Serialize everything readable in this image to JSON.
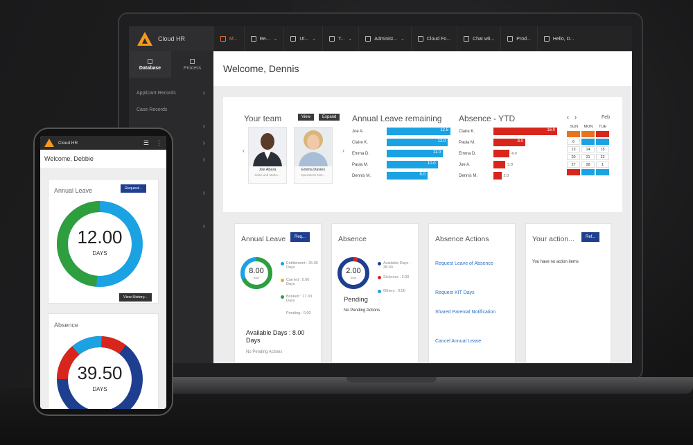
{
  "app": {
    "name": "Cloud HR"
  },
  "nav": [
    {
      "label": "M...",
      "icon": "arrows-icon",
      "active": true,
      "dropdown": false
    },
    {
      "label": "Re...",
      "icon": "report-icon",
      "active": false,
      "dropdown": true
    },
    {
      "label": "Ut...",
      "icon": "grid-icon",
      "active": false,
      "dropdown": true
    },
    {
      "label": "T...",
      "icon": "tools-icon",
      "active": false,
      "dropdown": true
    },
    {
      "label": "Administ...",
      "icon": "admin-icon",
      "active": false,
      "dropdown": true
    },
    {
      "label": "Cloud Fo...",
      "icon": "folder-icon",
      "active": false,
      "dropdown": false
    },
    {
      "label": "Chat wit...",
      "icon": "chat-icon",
      "active": false,
      "dropdown": false
    },
    {
      "label": "Prod...",
      "icon": "product-icon",
      "active": false,
      "dropdown": false
    },
    {
      "label": "Hello, D...",
      "icon": "user-icon",
      "active": false,
      "dropdown": false
    }
  ],
  "sidebar": {
    "tabs": [
      {
        "label": "Database",
        "active": true
      },
      {
        "label": "Process",
        "active": false
      }
    ],
    "items": [
      {
        "label": "Applicant Records",
        "has_arrow": true
      },
      {
        "label": "Case Records",
        "has_arrow": false
      },
      {
        "label": "",
        "has_arrow": true
      },
      {
        "label": "",
        "has_arrow": true
      },
      {
        "label": "",
        "has_arrow": true
      },
      {
        "label": "",
        "has_arrow": false
      },
      {
        "label": "",
        "has_arrow": true
      },
      {
        "label": "",
        "has_arrow": false
      },
      {
        "label": "",
        "has_arrow": true
      }
    ]
  },
  "main": {
    "welcome": "Welcome, Dennis"
  },
  "team": {
    "title": "Your team",
    "view_label": "View",
    "expand_label": "Expand",
    "people": [
      {
        "name": "Joe Abara",
        "role": "Sales and Marke..."
      },
      {
        "name": "Emma Davies",
        "role": "Operations Dire..."
      }
    ]
  },
  "leave_remaining": {
    "title": "Annual Leave remaining",
    "color": "#1ba2e3",
    "rows": [
      {
        "name": "Joe A.",
        "value": 12.5,
        "label": "12.5"
      },
      {
        "name": "Claire K.",
        "value": 12.0,
        "label": "12.0"
      },
      {
        "name": "Emma D.",
        "value": 11.0,
        "label": "11.0"
      },
      {
        "name": "Paula M.",
        "value": 10.0,
        "label": "10.0"
      },
      {
        "name": "Dennis M.",
        "value": 8.0,
        "label": "8.0"
      }
    ]
  },
  "absence_ytd": {
    "title": "Absence - YTD",
    "color": "#d9261c",
    "rows": [
      {
        "name": "Claire K.",
        "value": 16.0,
        "label": "16.0"
      },
      {
        "name": "Paula M.",
        "value": 8.0,
        "label": "8.0"
      },
      {
        "name": "Emma D.",
        "value": 4.0,
        "label": "4.0"
      },
      {
        "name": "Joe A.",
        "value": 3.0,
        "label": "3.0"
      },
      {
        "name": "Dennis M.",
        "value": 2.0,
        "label": "2.0"
      }
    ]
  },
  "calendar": {
    "month": "Feb",
    "days": [
      "SUN",
      "MON",
      "TUE"
    ],
    "cells": [
      {
        "t": "",
        "c": "#e8731f"
      },
      {
        "t": "",
        "c": "#e8731f"
      },
      {
        "t": "",
        "c": "#d9261c"
      },
      {
        "t": "6",
        "c": "#ffffff"
      },
      {
        "t": "",
        "c": "#1ba2e3"
      },
      {
        "t": "",
        "c": "#1ba2e3"
      },
      {
        "t": "13",
        "c": "#ffffff"
      },
      {
        "t": "14",
        "c": "#ffffff"
      },
      {
        "t": "15",
        "c": "#ffffff"
      },
      {
        "t": "20",
        "c": "#ffffff"
      },
      {
        "t": "21",
        "c": "#ffffff"
      },
      {
        "t": "22",
        "c": "#ffffff"
      },
      {
        "t": "27",
        "c": "#ffffff"
      },
      {
        "t": "28",
        "c": "#ffffff"
      },
      {
        "t": "1",
        "c": "#ffffff"
      },
      {
        "t": "",
        "c": "#d9261c"
      },
      {
        "t": "",
        "c": "#1ba2e3"
      },
      {
        "t": "",
        "c": "#1ba2e3"
      }
    ]
  },
  "annual_leave": {
    "title": "Annual Leave",
    "button": "Req...",
    "donut_value": "8.00",
    "donut_unit": "days",
    "legend": [
      {
        "label": "Entitlement : 25.00 Days",
        "color": "#1ba2e3"
      },
      {
        "label": "Carried : 0.00 Days",
        "color": "#f5a623"
      },
      {
        "label": "Booked : 17.00 Days",
        "color": "#2e9e3e"
      },
      {
        "label": "Pending : 0.00",
        "color": "#ffffff"
      }
    ],
    "available": "Available Days : 8.00 Days",
    "trailing": "No Pending Actions"
  },
  "absence": {
    "title": "Absence",
    "donut_value": "2.00",
    "donut_unit": "days",
    "legend": [
      {
        "label": "Available Days : 38.00",
        "color": "#1e3f8f"
      },
      {
        "label": "Sickness : 2.00",
        "color": "#d9261c"
      },
      {
        "label": "Others : 0.00",
        "color": "#1ba2e3"
      }
    ],
    "pending_title": "Pending",
    "pending_text": "No Pending Actions"
  },
  "absence_actions": {
    "title": "Absence Actions",
    "links": [
      "Request Leave of Absence",
      "Request KIT Days",
      "Shared Parental Notification",
      "Cancel Annual Leave"
    ]
  },
  "your_actions": {
    "title": "Your action...",
    "button": "Ref...",
    "text": "You have no action items"
  },
  "phone": {
    "app_name": "Cloud HR",
    "welcome": "Welcome, Debbie",
    "annual": {
      "title": "Annual Leave",
      "button": "Request...",
      "value": "12.00",
      "unit": "DAYS",
      "history": "View History..."
    },
    "absence": {
      "title": "Absence",
      "value": "39.50",
      "unit": "DAYS"
    }
  }
}
